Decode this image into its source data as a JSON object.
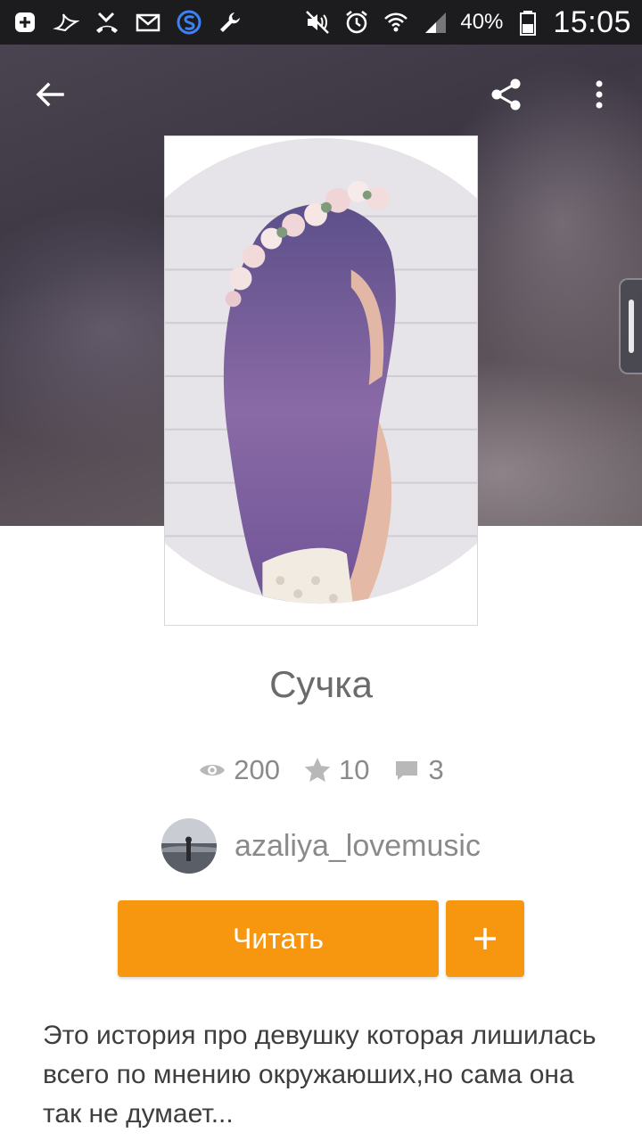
{
  "status_bar": {
    "battery_percent": "40%",
    "time": "15:05",
    "icons_left": [
      "add-box-icon",
      "swallow-icon",
      "missed-call-icon",
      "mail-icon",
      "s-app-icon",
      "wrench-icon"
    ],
    "icons_right": [
      "mute-icon",
      "alarm-icon",
      "wifi-icon",
      "signal-icon",
      "battery-icon"
    ]
  },
  "toolbar": {
    "back_icon": "arrow-left-icon",
    "share_icon": "share-icon",
    "more_icon": "more-vertical-icon"
  },
  "book": {
    "title": "Сучка",
    "stats": {
      "views": "200",
      "votes": "10",
      "comments": "3"
    },
    "author": "azaliya_lovemusic",
    "read_label": "Читать",
    "add_icon": "plus-icon",
    "description": "Это история про девушку которая лишилась всего по мнению окружаюших,но сама она так не думает..."
  },
  "colors": {
    "accent": "#f7960f",
    "status_bar": "#1c1c1e",
    "title_text": "#6b6b6b",
    "muted_text": "#8a8a8a"
  }
}
